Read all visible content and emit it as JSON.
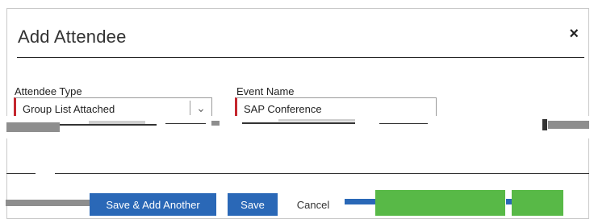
{
  "dialog": {
    "title": "Add Attendee",
    "close_label": "×"
  },
  "form": {
    "attendee_type": {
      "label": "Attendee Type",
      "value": "Group List Attached"
    },
    "event_name": {
      "label": "Event Name",
      "value": "SAP Conference"
    }
  },
  "footer": {
    "save_add_another_label": "Save & Add Another",
    "save_label": "Save",
    "cancel_label": "Cancel"
  },
  "colors": {
    "primary_button": "#2a68b7",
    "required_marker": "#c4262e",
    "green_button": "#58b947"
  }
}
